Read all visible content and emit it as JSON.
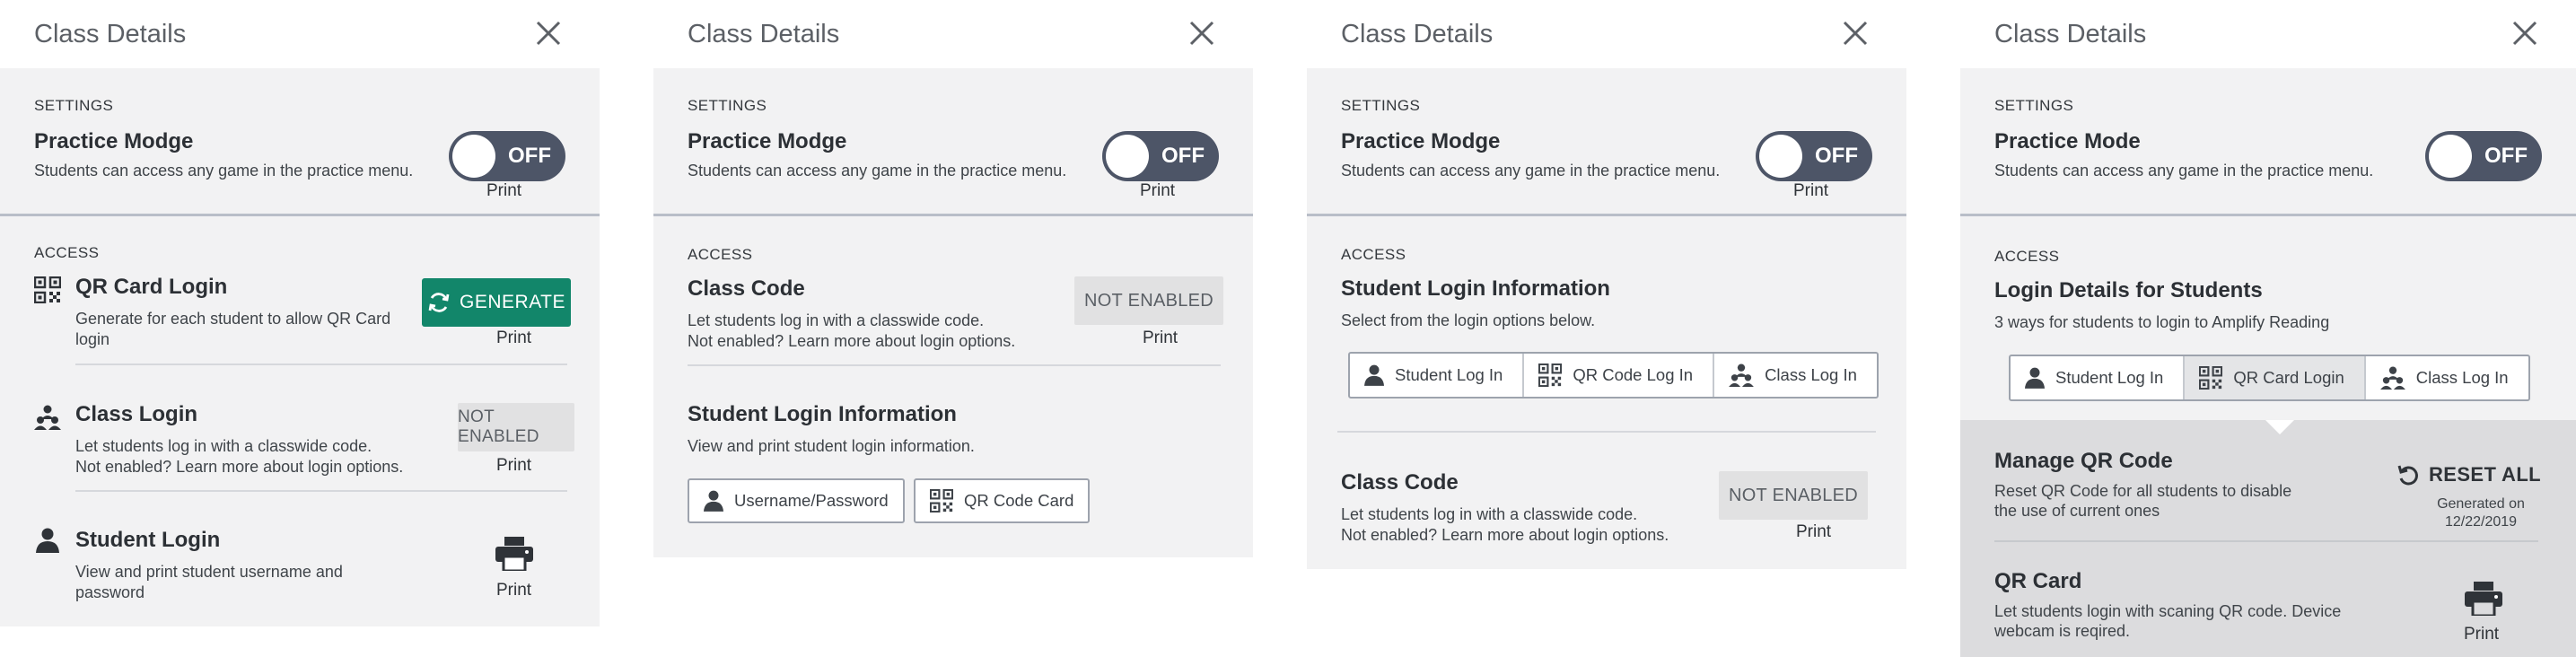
{
  "panels": [
    {
      "title": "Class Details",
      "settings": {
        "section_label": "SETTINGS",
        "practice_title": "Practice Modge",
        "practice_desc": "Students can access any game in the practice menu.",
        "toggle_label": "OFF",
        "print_label": "Print"
      },
      "access": {
        "section_label": "ACCESS",
        "qr_title": "QR Card Login",
        "qr_desc_1": "Generate for each student to allow QR Card",
        "qr_desc_2": "login",
        "generate_label": "GENERATE",
        "qr_print": "Print",
        "class_title": "Class Login",
        "class_desc_1": "Let students log in with a classwide code.",
        "class_desc_2": "Not enabled? Learn more about login options.",
        "class_status": "NOT ENABLED",
        "class_print": "Print",
        "student_title": "Student Login",
        "student_desc_1": "View and print student username and",
        "student_desc_2": "password",
        "student_print": "Print"
      }
    },
    {
      "title": "Class Details",
      "settings": {
        "section_label": "SETTINGS",
        "practice_title": "Practice Modge",
        "practice_desc": "Students can access any game in the practice menu.",
        "toggle_label": "OFF",
        "print_label": "Print"
      },
      "access": {
        "section_label": "ACCESS",
        "class_code_title": "Class Code",
        "class_code_desc_1": "Let students log in with a classwide code.",
        "class_code_desc_2": "Not enabled? Learn more about login options.",
        "class_code_status": "NOT ENABLED",
        "class_code_print": "Print",
        "sli_title": "Student Login Information",
        "sli_desc": "View and print student login information.",
        "btn_username": "Username/Password",
        "btn_qr": "QR Code Card"
      }
    },
    {
      "title": "Class Details",
      "settings": {
        "section_label": "SETTINGS",
        "practice_title": "Practice Modge",
        "practice_desc": "Students can access any game in the practice menu.",
        "toggle_label": "OFF",
        "print_label": "Print"
      },
      "access": {
        "section_label": "ACCESS",
        "sli_title": "Student Login Information",
        "sli_desc": "Select from the login options below.",
        "tabs": [
          "Student Log In",
          "QR Code Log In",
          "Class Log In"
        ],
        "class_code_title": "Class Code",
        "class_code_desc_1": "Let students log in with a classwide code.",
        "class_code_desc_2": "Not enabled? Learn more about login options.",
        "class_code_status": "NOT ENABLED",
        "class_code_print": "Print"
      }
    },
    {
      "title": "Class Details",
      "settings": {
        "section_label": "SETTINGS",
        "practice_title": "Practice Mode",
        "practice_desc": "Students can access any game in the practice menu.",
        "toggle_label": "OFF"
      },
      "access": {
        "section_label": "ACCESS",
        "lds_title": "Login Details for Students",
        "lds_desc": "3 ways for students to login to Amplify Reading",
        "tabs": [
          "Student Log In",
          "QR Card Login",
          "Class Log In"
        ],
        "manage_title": "Manage QR Code",
        "manage_desc_1": "Reset QR Code for all students to disable",
        "manage_desc_2": "the use of current ones",
        "reset_label": "RESET ALL",
        "generated_on": "Generated on",
        "generated_date": "12/22/2019",
        "qr_card_title": "QR Card",
        "qr_card_desc_1": "Let students login with scaning QR code. Device",
        "qr_card_desc_2": "webcam is reqired.",
        "qr_card_print": "Print"
      }
    }
  ],
  "colors": {
    "accent_green": "#12866a",
    "toggle_bg": "#4d5567",
    "panel_gray": "#f2f2f3",
    "expanded_gray": "#dcdcde"
  }
}
